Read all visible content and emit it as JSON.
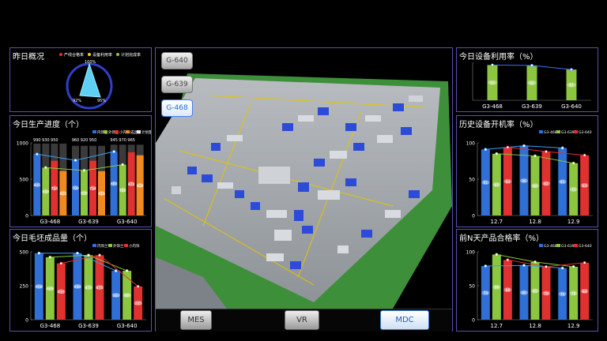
{
  "colors": {
    "blue": "#2f6fd6",
    "green": "#8cc63f",
    "red": "#e03030",
    "orange": "#f08a20",
    "dark": "#3a3a3a",
    "panel_border": "#5a4fb0"
  },
  "yesterday": {
    "title": "昨日概况",
    "legend": [
      "产线合格率",
      "设备利用率",
      "计划完成率"
    ],
    "radar_ticks": [
      "100%",
      "92%",
      "95%"
    ],
    "chart_data": {
      "type": "radar",
      "axes": [
        "产线合格率",
        "设备利用率",
        "计划完成率"
      ],
      "values": [
        100,
        92,
        95
      ],
      "ylim": [
        0,
        100
      ]
    }
  },
  "progress": {
    "title": "今日生产进度（个）",
    "legend": [
      "内饰兰",
      "外饰兰",
      "小内饰",
      "成品量",
      "计划量"
    ],
    "chart_data": {
      "type": "bar",
      "categories": [
        "G3-468",
        "G3-639",
        "G3-640"
      ],
      "ylim": [
        0,
        1000
      ],
      "yticks": [
        0,
        500,
        1000
      ],
      "series": [
        {
          "name": "内饰兰",
          "values": [
            845,
            760,
            880
          ]
        },
        {
          "name": "外饰兰",
          "values": [
            659,
            620,
            700
          ]
        },
        {
          "name": "小内饰",
          "values": [
            754,
            754,
            870
          ]
        },
        {
          "name": "成品量",
          "values": [
            613,
            610,
            829
          ]
        },
        {
          "name": "计划量",
          "values": [
            990,
            960,
            975
          ]
        }
      ],
      "top_labels": [
        "990",
        "930",
        "950",
        "960",
        "920",
        "950",
        "945",
        "970",
        "965"
      ],
      "bar_labels": [
        "845",
        "659",
        "754",
        "613",
        "760",
        "620",
        "754",
        "610",
        "880",
        "700",
        "870",
        "829"
      ]
    }
  },
  "yield_today": {
    "title": "今日毛坯成品量（个）",
    "legend": [
      "内饰兰",
      "外饰兰",
      "小内饰"
    ],
    "chart_data": {
      "type": "bar",
      "categories": [
        "G3-468",
        "G3-639",
        "G3-640"
      ],
      "ylim": [
        0,
        500
      ],
      "yticks": [
        0,
        250,
        500
      ],
      "series": [
        {
          "name": "内饰兰",
          "values": [
            490,
            490,
            360
          ]
        },
        {
          "name": "外饰兰",
          "values": [
            460,
            475,
            360
          ]
        },
        {
          "name": "小内饰",
          "values": [
            415,
            475,
            245
          ]
        }
      ],
      "bar_labels": [
        "490",
        "460",
        "415",
        "490",
        "475",
        "475",
        "360",
        "360",
        "245"
      ]
    }
  },
  "util_today": {
    "title": "今日设备利用率（%）",
    "chart_data": {
      "type": "bar",
      "categories": [
        "G3-468",
        "G3-639",
        "G3-640"
      ],
      "values": [
        93,
        92,
        81
      ],
      "ylim": [
        0,
        100
      ],
      "bar_labels": [
        "93",
        "92",
        "81"
      ]
    }
  },
  "history_rate": {
    "title": "历史设备开机率（%）",
    "legend": [
      "G3-468",
      "G3-639",
      "G3-640"
    ],
    "chart_data": {
      "type": "bar",
      "categories": [
        "12.7",
        "12.8",
        "12.9"
      ],
      "ylim": [
        0,
        100
      ],
      "yticks": [
        0,
        50,
        100
      ],
      "series": [
        {
          "name": "G3-468",
          "values": [
            91,
            96,
            93
          ]
        },
        {
          "name": "G3-639",
          "values": [
            85,
            82,
            72
          ]
        },
        {
          "name": "G3-640",
          "values": [
            94,
            88,
            83
          ]
        }
      ],
      "bar_labels": [
        "91",
        "85",
        "94",
        "96",
        "88",
        "82",
        "93",
        "72",
        "83"
      ]
    }
  },
  "pass_rate": {
    "title": "前N天产品合格率（%）",
    "legend": [
      "G3-468",
      "G3-639",
      "G3-640"
    ],
    "chart_data": {
      "type": "bar",
      "categories": [
        "12.7",
        "12.8",
        "12.9"
      ],
      "ylim": [
        0,
        100
      ],
      "yticks": [
        0,
        50,
        100
      ],
      "series": [
        {
          "name": "G3-468",
          "values": [
            79,
            80,
            76
          ]
        },
        {
          "name": "G3-639",
          "values": [
            96,
            85,
            78
          ]
        },
        {
          "name": "G3-640",
          "values": [
            88,
            78,
            84
          ]
        }
      ],
      "bar_labels": [
        "79",
        "96",
        "88",
        "80",
        "85",
        "78",
        "76",
        "78",
        "84"
      ]
    }
  },
  "views": {
    "buttons": [
      "G-640",
      "G-639",
      "G-468"
    ],
    "active": "G-468"
  },
  "nav": {
    "mes": "MES",
    "vr": "VR",
    "mdc": "MDC"
  }
}
